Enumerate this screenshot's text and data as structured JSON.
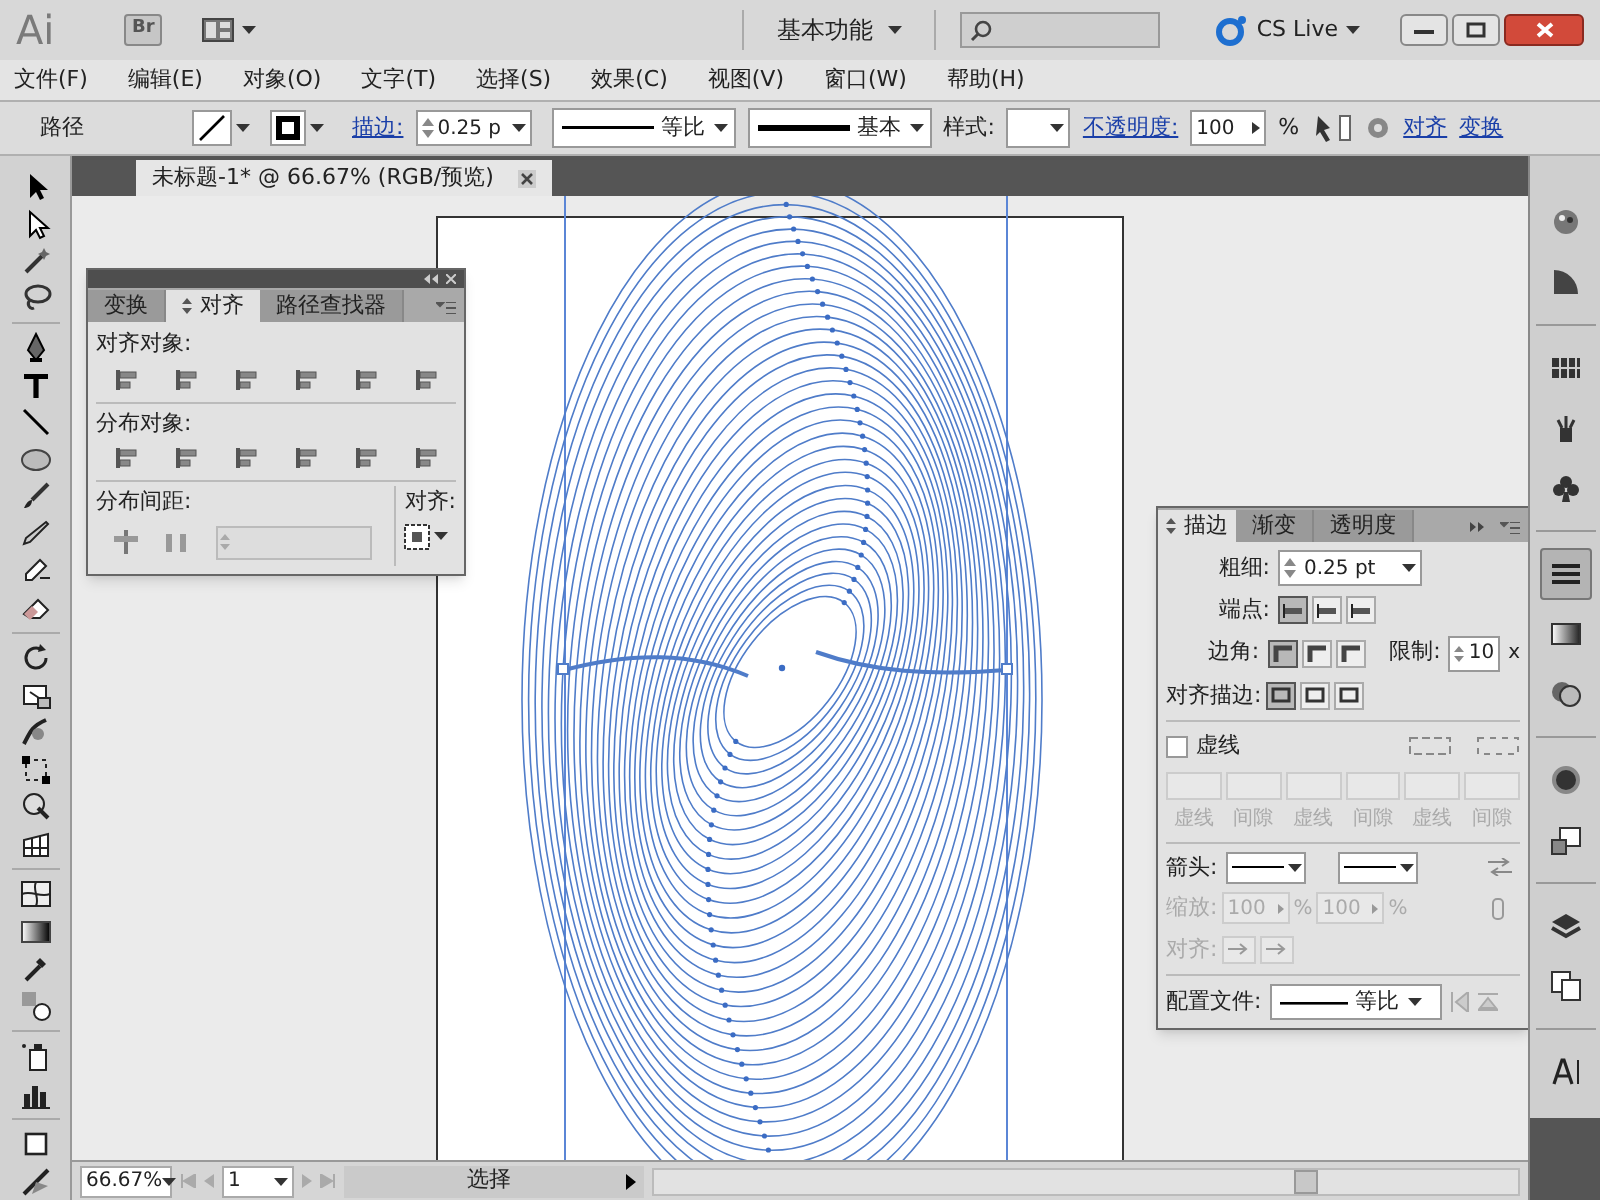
{
  "app_bar": {
    "logo": "Ai",
    "bridge": "Br",
    "workspace": "基本功能",
    "cs_live": "CS Live"
  },
  "menu": [
    "文件(F)",
    "编辑(E)",
    "对象(O)",
    "文字(T)",
    "选择(S)",
    "效果(C)",
    "视图(V)",
    "窗口(W)",
    "帮助(H)"
  ],
  "control_bar": {
    "selection": "路径",
    "stroke_label": "描边:",
    "stroke_weight": "0.25 p",
    "profile": "等比",
    "brush": "基本",
    "style_label": "样式:",
    "opacity_label": "不透明度:",
    "opacity": "100",
    "percent": "%",
    "align_link": "对齐",
    "transform_link": "变换"
  },
  "document_tab": {
    "title": "未标题-1* @ 66.67% (RGB/预览)"
  },
  "align_panel": {
    "tabs": [
      {
        "label": "变换",
        "selected": false
      },
      {
        "label": "对齐",
        "selected": true
      },
      {
        "label": "路径查找器",
        "selected": false
      }
    ],
    "align_objects": "对齐对象:",
    "distribute_objects": "分布对象:",
    "distribute_spacing": "分布间距:",
    "align_to": "对齐:"
  },
  "stroke_panel": {
    "tabs": [
      {
        "label": "描边",
        "selected": true
      },
      {
        "label": "渐变",
        "selected": false
      },
      {
        "label": "透明度",
        "selected": false
      }
    ],
    "weight_label": "粗细:",
    "weight": "0.25 pt",
    "cap_label": "端点:",
    "caps": [
      {
        "selected": true
      },
      {
        "selected": false
      },
      {
        "selected": false
      }
    ],
    "corner_label": "边角:",
    "corners": [
      {
        "selected": true
      },
      {
        "selected": false
      },
      {
        "selected": false
      }
    ],
    "limit_label": "限制:",
    "limit": "10",
    "limit_unit": "x",
    "align_label": "对齐描边:",
    "align_stroke": [
      {
        "selected": true
      },
      {
        "selected": false
      },
      {
        "selected": false
      }
    ],
    "dashed": {
      "label": "虚线",
      "checked": false
    },
    "dash_fields": [
      {
        "label": "虚线"
      },
      {
        "label": "间隙"
      },
      {
        "label": "虚线"
      },
      {
        "label": "间隙"
      },
      {
        "label": "虚线"
      },
      {
        "label": "间隙"
      }
    ],
    "arrowheads_label": "箭头:",
    "arrow_scale": {
      "label": "缩放:",
      "start": "100",
      "end": "100",
      "unit_1": "%",
      "unit_2": "%",
      "disabled": true
    },
    "arrow_align": {
      "label": "对齐:",
      "disabled": true
    },
    "profile_label": "配置文件:",
    "profile": "等比"
  },
  "status_bar": {
    "zoom": "66.67%",
    "page": "1",
    "tool": "选择"
  }
}
